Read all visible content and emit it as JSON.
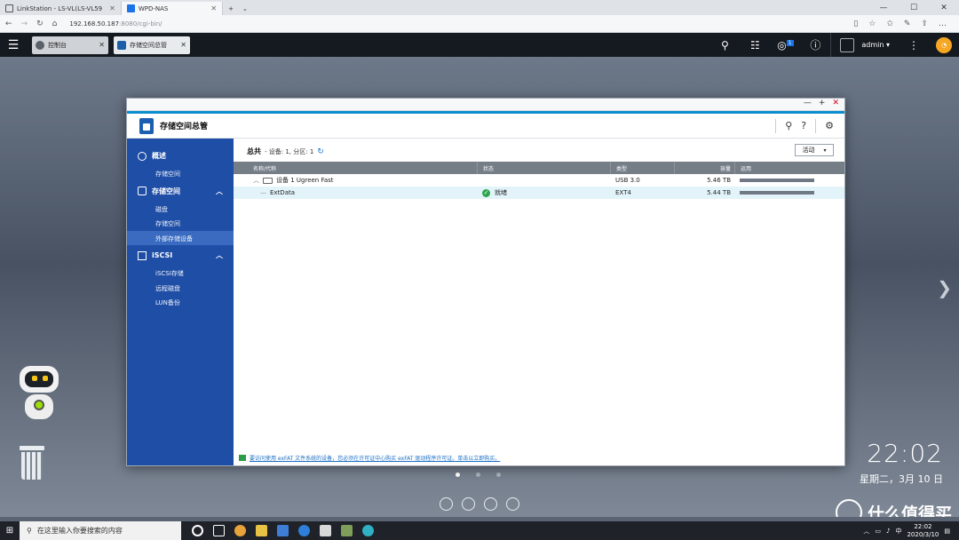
{
  "browser": {
    "tabs": [
      {
        "label": "LinkStation - LS-VL(LS-VL59",
        "active": false
      },
      {
        "label": "WPD-NAS",
        "active": true
      }
    ],
    "new_tab": "+",
    "url_host": "192.168.50.187",
    "url_path": ":8080/cgi-bin/"
  },
  "qts": {
    "tabs": [
      {
        "label": "控制台"
      },
      {
        "label": "存储空间总管"
      }
    ],
    "user": "admin ▾",
    "notif_badge": "1"
  },
  "window": {
    "title": "存储空间总管"
  },
  "sidebar": {
    "sections": [
      {
        "label": "概述",
        "items": [
          "存储空间"
        ]
      },
      {
        "label": "存储空间",
        "items": [
          "磁盘",
          "存储空间",
          "外部存储设备"
        ]
      },
      {
        "label": "iSCSI",
        "items": [
          "iSCSI存储",
          "远程磁盘",
          "LUN备份"
        ]
      }
    ],
    "selected": "外部存储设备"
  },
  "main": {
    "summary_label": "总共",
    "summary_detail": "- 设备: 1, 分区: 1",
    "dropdown": "活动",
    "columns": [
      "名称/代称",
      "状态",
      "类型",
      "容量",
      "运用"
    ],
    "rows": [
      {
        "name": "设备 1 Ugreen Fast",
        "status": "",
        "type": "USB 3.0",
        "capacity": "5.46 TB",
        "usage": 1.0
      },
      {
        "name": "ExtData",
        "status": "就绪",
        "type": "EXT4",
        "capacity": "5.44 TB",
        "usage": 1.0
      }
    ],
    "footnote": "要访问使用 exFAT 文件系统的设备，您必须在许可证中心购买 exFAT 驱动程序许可证。单击以立即购买。"
  },
  "desktop": {
    "time": "22:02",
    "date": "星期二，3月 10 日",
    "brand": "什么值得买"
  },
  "taskbar": {
    "search_placeholder": "在这里输入你要搜索的内容",
    "time": "22:02",
    "date": "2020/3/10"
  },
  "colors": {
    "sidebar": "#1f4ea6",
    "accent": "#0b8ed0",
    "selected_row": "#e2f4fa"
  }
}
